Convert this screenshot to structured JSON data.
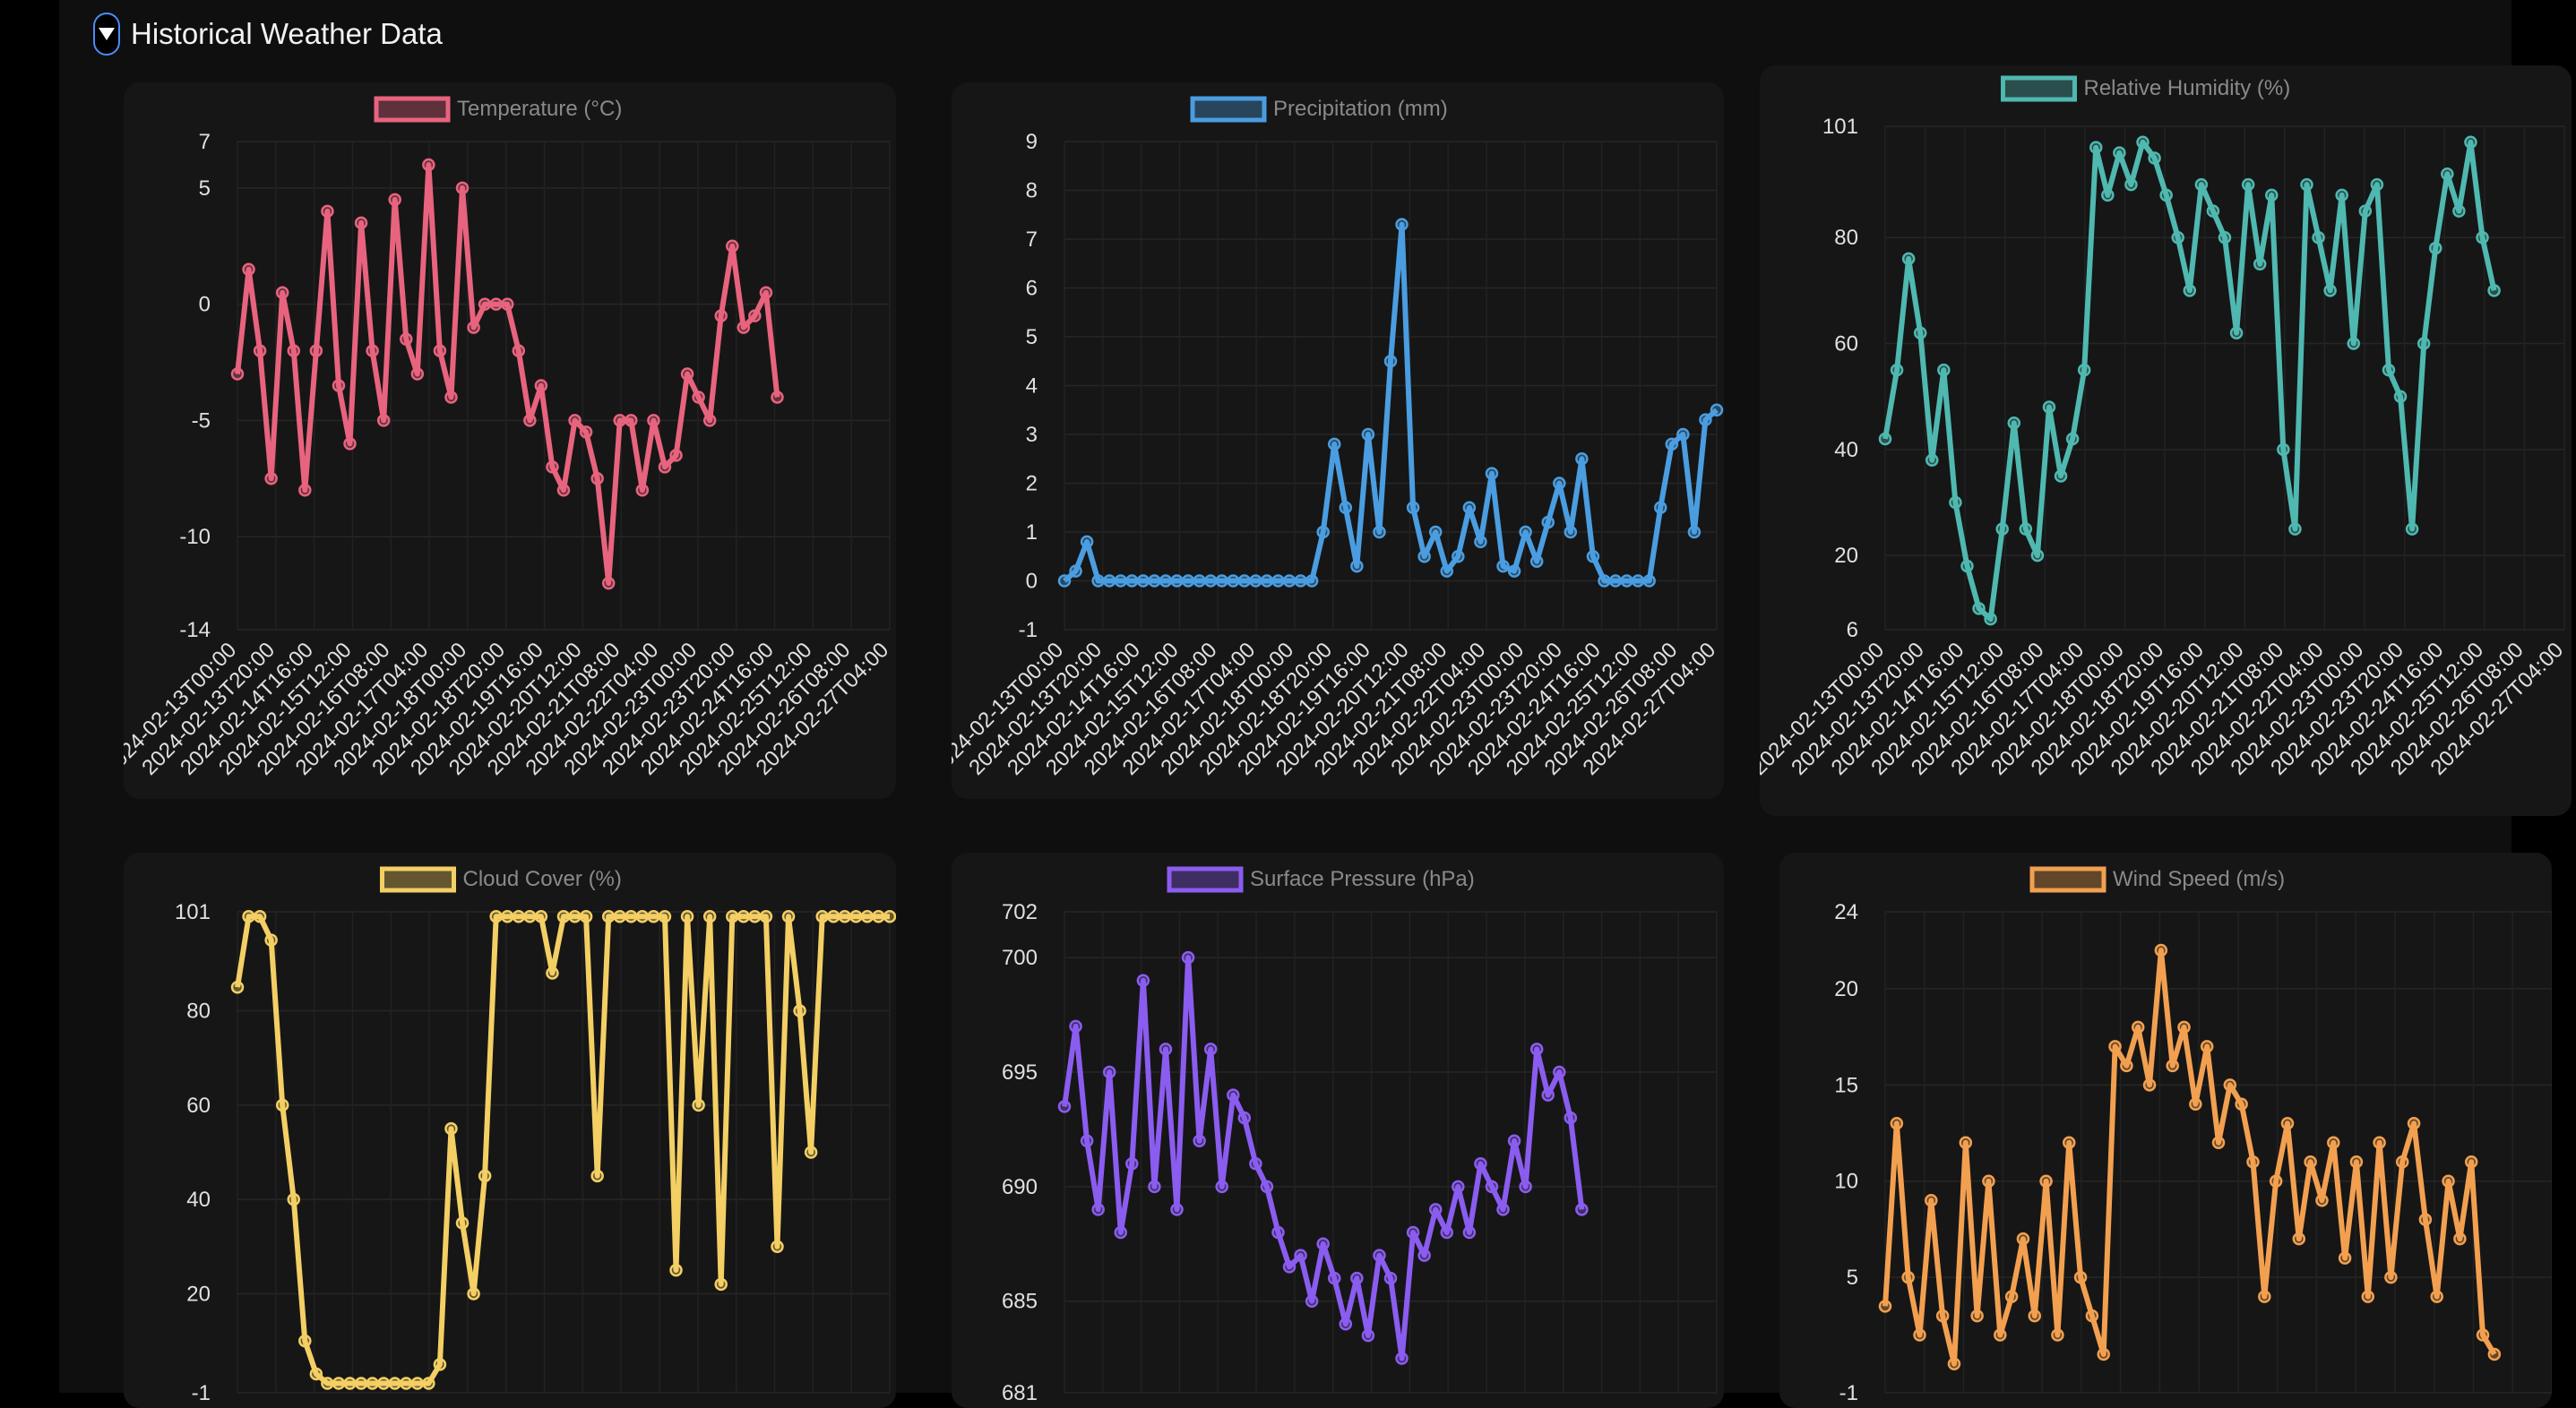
{
  "section": {
    "title": "Historical Weather Data",
    "toggle_icon": "triangle-down-icon"
  },
  "x_tick_labels": [
    "2024-02-13T00:00",
    "2024-02-13T20:00",
    "2024-02-14T16:00",
    "2024-02-15T12:00",
    "2024-02-16T08:00",
    "2024-02-17T04:00",
    "2024-02-18T00:00",
    "2024-02-18T20:00",
    "2024-02-19T16:00",
    "2024-02-20T12:00",
    "2024-02-21T08:00",
    "2024-02-22T04:00",
    "2024-02-23T00:00",
    "2024-02-23T20:00",
    "2024-02-24T16:00",
    "2024-02-25T12:00",
    "2024-02-26T08:00",
    "2024-02-27T04:00"
  ],
  "chart_data": [
    {
      "id": "temperature",
      "type": "line",
      "legend": "Temperature (°C)",
      "color": "#e8637e",
      "yticks": [
        7,
        5,
        0,
        -5,
        -10,
        -14
      ],
      "ylim": [
        -14,
        7
      ],
      "x": [
        0,
        6,
        12,
        18,
        24,
        30,
        36,
        42,
        48,
        54,
        60,
        66,
        72,
        78,
        84,
        90,
        96,
        102,
        108,
        114,
        120,
        126,
        132,
        138,
        144,
        150,
        156,
        162,
        168,
        174,
        180,
        186,
        192,
        198,
        204,
        210,
        216,
        222,
        228,
        234,
        240,
        246,
        252,
        258,
        264,
        270,
        276,
        282,
        288,
        294,
        300,
        306,
        312,
        318,
        324,
        330,
        336,
        342,
        348
      ],
      "y": [
        -3,
        1.5,
        -2,
        -7.5,
        0.5,
        -2,
        -8,
        -2,
        4,
        -3.5,
        -6,
        3.5,
        -2,
        -5,
        4.5,
        -1.5,
        -3,
        6,
        -2,
        -4,
        5,
        -1,
        0,
        0,
        0,
        -2,
        -5,
        -3.5,
        -7,
        -8,
        -5,
        -5.5,
        -7.5,
        -12,
        -5,
        -5,
        -8,
        -5,
        -7,
        -6.5,
        -3,
        -4,
        -5,
        -0.5,
        2.5,
        -1,
        -0.5,
        0.5,
        -4
      ]
    },
    {
      "id": "precipitation",
      "type": "line",
      "legend": "Precipitation (mm)",
      "color": "#4a9de0",
      "yticks": [
        9,
        8,
        7,
        6,
        5,
        4,
        3,
        2,
        1,
        0,
        -1
      ],
      "ylim": [
        -1,
        9
      ],
      "x": [
        0,
        6,
        12,
        18,
        24,
        30,
        36,
        42,
        48,
        54,
        60,
        66,
        72,
        78,
        84,
        90,
        96,
        102,
        108,
        114,
        120,
        126,
        132,
        138,
        144,
        150,
        156,
        162,
        168,
        174,
        180,
        186,
        192,
        198,
        204,
        210,
        216,
        222,
        228,
        234,
        240,
        246,
        252,
        258,
        264,
        270,
        276,
        282,
        288,
        294,
        300,
        306,
        312,
        318,
        324,
        330,
        336,
        342,
        348
      ],
      "y": [
        0,
        0.2,
        0.8,
        0,
        0,
        0,
        0,
        0,
        0,
        0,
        0,
        0,
        0,
        0,
        0,
        0,
        0,
        0,
        0,
        0,
        0,
        0,
        0,
        1,
        2.8,
        1.5,
        0.3,
        3,
        1,
        4.5,
        7.3,
        1.5,
        0.5,
        1,
        0.2,
        0.5,
        1.5,
        0.8,
        2.2,
        0.3,
        0.2,
        1,
        0.4,
        1.2,
        2,
        1,
        2.5,
        0.5,
        0,
        0,
        0,
        0,
        0,
        1.5,
        2.8,
        3,
        1,
        3.3,
        3.5
      ]
    },
    {
      "id": "humidity",
      "type": "line",
      "legend": "Relative Humidity (%)",
      "color": "#4fb8b0",
      "yticks": [
        101,
        80,
        60,
        40,
        20,
        6
      ],
      "ylim": [
        6,
        101
      ],
      "x": [
        0,
        6,
        12,
        18,
        24,
        30,
        36,
        42,
        48,
        54,
        60,
        66,
        72,
        78,
        84,
        90,
        96,
        102,
        108,
        114,
        120,
        126,
        132,
        138,
        144,
        150,
        156,
        162,
        168,
        174,
        180,
        186,
        192,
        198,
        204,
        210,
        216,
        222,
        228,
        234,
        240,
        246,
        252,
        258,
        264,
        270,
        276,
        282,
        288,
        294,
        300,
        306,
        312,
        318,
        324,
        330,
        336,
        342,
        348
      ],
      "y": [
        42,
        55,
        76,
        62,
        38,
        55,
        30,
        18,
        10,
        8,
        25,
        45,
        25,
        20,
        48,
        35,
        42,
        55,
        97,
        88,
        96,
        90,
        98,
        95,
        88,
        80,
        70,
        90,
        85,
        80,
        62,
        90,
        75,
        88,
        40,
        25,
        90,
        80,
        70,
        88,
        60,
        85,
        90,
        55,
        50,
        25,
        60,
        78,
        92,
        85,
        98,
        80,
        70
      ]
    },
    {
      "id": "cloudcover",
      "type": "line",
      "legend": "Cloud Cover (%)",
      "color": "#f3cf64",
      "yticks": [
        101,
        80,
        60,
        40,
        20,
        -1
      ],
      "ylim": [
        -1,
        101
      ],
      "x": [
        0,
        6,
        12,
        18,
        24,
        30,
        36,
        42,
        48,
        54,
        60,
        66,
        72,
        78,
        84,
        90,
        96,
        102,
        108,
        114,
        120,
        126,
        132,
        138,
        144,
        150,
        156,
        162,
        168,
        174,
        180,
        186,
        192,
        198,
        204,
        210,
        216,
        222,
        228,
        234,
        240,
        246,
        252,
        258,
        264,
        270,
        276,
        282,
        288,
        294,
        300,
        306,
        312,
        318,
        324,
        330,
        336,
        342,
        348
      ],
      "y": [
        85,
        100,
        100,
        95,
        60,
        40,
        10,
        3,
        1,
        1,
        1,
        1,
        1,
        1,
        1,
        1,
        1,
        1,
        5,
        55,
        35,
        20,
        45,
        100,
        100,
        100,
        100,
        100,
        88,
        100,
        100,
        100,
        45,
        100,
        100,
        100,
        100,
        100,
        100,
        25,
        100,
        60,
        100,
        22,
        100,
        100,
        100,
        100,
        30,
        100,
        80,
        50,
        100,
        100,
        100,
        100,
        100,
        100,
        100
      ]
    },
    {
      "id": "pressure",
      "type": "line",
      "legend": "Surface Pressure (hPa)",
      "color": "#8b5cf0",
      "yticks": [
        702,
        700,
        695,
        690,
        685,
        681
      ],
      "ylim": [
        681,
        702
      ],
      "x": [
        0,
        6,
        12,
        18,
        24,
        30,
        36,
        42,
        48,
        54,
        60,
        66,
        72,
        78,
        84,
        90,
        96,
        102,
        108,
        114,
        120,
        126,
        132,
        138,
        144,
        150,
        156,
        162,
        168,
        174,
        180,
        186,
        192,
        198,
        204,
        210,
        216,
        222,
        228,
        234,
        240,
        246,
        252,
        258,
        264,
        270,
        276,
        282,
        288,
        294,
        300,
        306,
        312,
        318,
        324,
        330,
        336,
        342,
        348
      ],
      "y": [
        693.5,
        697,
        692,
        689,
        695,
        688,
        691,
        699,
        690,
        696,
        689,
        700,
        692,
        696,
        690,
        694,
        693,
        691,
        690,
        688,
        686.5,
        687,
        685,
        687.5,
        686,
        684,
        686,
        683.5,
        687,
        686,
        682.5,
        688,
        687,
        689,
        688,
        690,
        688,
        691,
        690,
        689,
        692,
        690,
        696,
        694,
        695,
        693,
        689
      ]
    },
    {
      "id": "windspeed",
      "type": "line",
      "legend": "Wind Speed (m/s)",
      "color": "#f2a050",
      "yticks": [
        24,
        20,
        15,
        10,
        5,
        -1
      ],
      "ylim": [
        -1,
        24
      ],
      "x": [
        0,
        6,
        12,
        18,
        24,
        30,
        36,
        42,
        48,
        54,
        60,
        66,
        72,
        78,
        84,
        90,
        96,
        102,
        108,
        114,
        120,
        126,
        132,
        138,
        144,
        150,
        156,
        162,
        168,
        174,
        180,
        186,
        192,
        198,
        204,
        210,
        216,
        222,
        228,
        234,
        240,
        246,
        252,
        258,
        264,
        270,
        276,
        282,
        288,
        294,
        300,
        306,
        312,
        318,
        324,
        330,
        336,
        342,
        348
      ],
      "y": [
        3.5,
        13,
        5,
        2,
        9,
        3,
        0.5,
        12,
        3,
        10,
        2,
        4,
        7,
        3,
        10,
        2,
        12,
        5,
        3,
        1,
        17,
        16,
        18,
        15,
        22,
        16,
        18,
        14,
        17,
        12,
        15,
        14,
        11,
        4,
        10,
        13,
        7,
        11,
        9,
        12,
        6,
        11,
        4,
        12,
        5,
        11,
        13,
        8,
        4,
        10,
        7,
        11,
        2,
        1
      ]
    }
  ]
}
